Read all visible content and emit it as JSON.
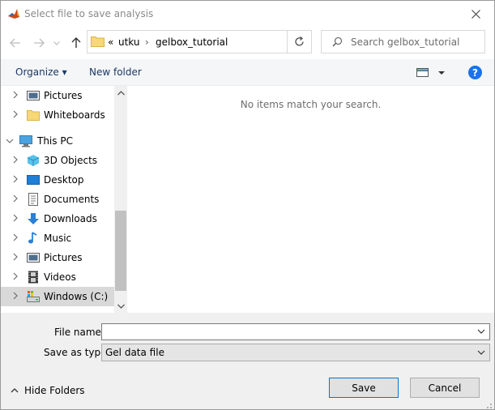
{
  "window": {
    "title": "Select file to save analysis"
  },
  "nav": {
    "address_overflow": "«",
    "breadcrumbs": [
      "utku",
      "gelbox_tutorial"
    ],
    "search_placeholder": "Search gelbox_tutorial"
  },
  "toolbar": {
    "organize_label": "Organize ▾",
    "new_folder_label": "New folder",
    "help_label": "?"
  },
  "tree": {
    "items": [
      {
        "label": "Pictures",
        "icon": "pictures-icon",
        "level": 1
      },
      {
        "label": "Whiteboards",
        "icon": "folder-icon",
        "level": 1
      },
      {
        "label": "This PC",
        "icon": "pc-icon",
        "level": 0
      },
      {
        "label": "3D Objects",
        "icon": "3d-objects-icon",
        "level": 1
      },
      {
        "label": "Desktop",
        "icon": "desktop-icon",
        "level": 1
      },
      {
        "label": "Documents",
        "icon": "documents-icon",
        "level": 1
      },
      {
        "label": "Downloads",
        "icon": "downloads-icon",
        "level": 1
      },
      {
        "label": "Music",
        "icon": "music-icon",
        "level": 1
      },
      {
        "label": "Pictures",
        "icon": "pictures-icon",
        "level": 1
      },
      {
        "label": "Videos",
        "icon": "videos-icon",
        "level": 1
      },
      {
        "label": "Windows (C:)",
        "icon": "drive-icon",
        "level": 1,
        "selected": true
      }
    ]
  },
  "content": {
    "empty_message": "No items match your search."
  },
  "form": {
    "file_name_label": "File name:",
    "file_name_value": "",
    "save_type_label": "Save as type:",
    "save_type_value": "Gel data file"
  },
  "footer": {
    "hide_folders_label": "Hide Folders",
    "save_label": "Save",
    "cancel_label": "Cancel"
  },
  "colors": {
    "accent": "#0078d7",
    "link": "#1a3865",
    "folder": "#f8d775"
  }
}
